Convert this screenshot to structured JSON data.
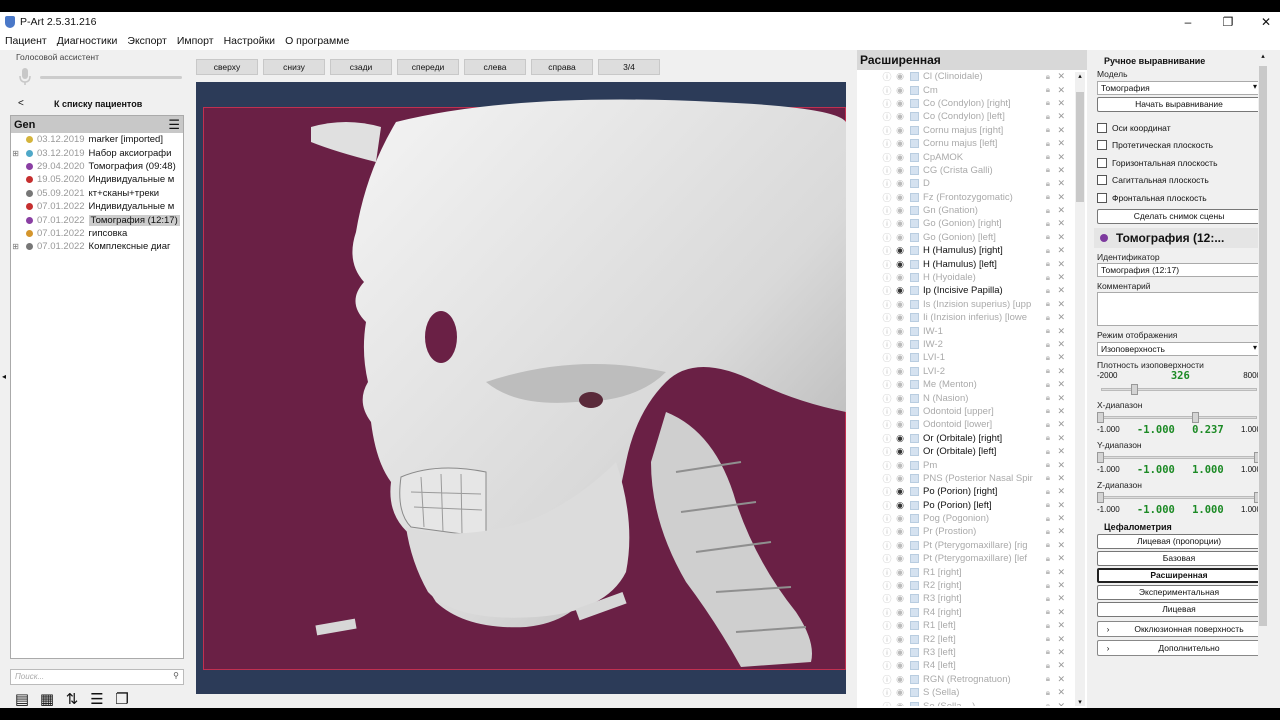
{
  "window": {
    "title": "P-Art 2.5.31.216",
    "minimize": "–",
    "maximize": "❐",
    "close": "✕"
  },
  "menu": [
    "Пациент",
    "Диагностики",
    "Экспорт",
    "Импорт",
    "Настройки",
    "О программе"
  ],
  "left": {
    "voice_label": "Голосовой ассистент",
    "back_label": "К списку пациентов",
    "patient_name": "Gen",
    "search_placeholder": "Поиск...",
    "items": [
      {
        "date": "03.12.2019",
        "label": "marker [imported]",
        "color": "#d4b43c",
        "expand": ""
      },
      {
        "date": "03.12.2019",
        "label": "Набор аксиографи",
        "color": "#4fa8c8",
        "expand": "⊞"
      },
      {
        "date": "29.04.2020",
        "label": "Томография (09:48)",
        "color": "#8a3fa3",
        "expand": ""
      },
      {
        "date": "19.05.2020",
        "label": "Индивидуальные м",
        "color": "#c62f2f",
        "expand": ""
      },
      {
        "date": "05.09.2021",
        "label": "кт+сканы+треки",
        "color": "#777777",
        "expand": ""
      },
      {
        "date": "07.01.2022",
        "label": "Индивидуальные м",
        "color": "#c62f2f",
        "expand": ""
      },
      {
        "date": "07.01.2022",
        "label": "Томография (12:17)",
        "color": "#8a3fa3",
        "expand": ""
      },
      {
        "date": "07.01.2022",
        "label": "гипсовка",
        "color": "#d4952c",
        "expand": ""
      },
      {
        "date": "07.01.2022",
        "label": "Комплексные диаг",
        "color": "#777777",
        "expand": "⊞"
      }
    ]
  },
  "views": [
    "сверху",
    "снизу",
    "сзади",
    "спереди",
    "слева",
    "справа",
    "3/4"
  ],
  "landmarks": {
    "title": "Расширенная",
    "items": [
      {
        "name": "Cl (Clinoidale)",
        "on": false
      },
      {
        "name": "Cm",
        "on": false
      },
      {
        "name": "Co (Condylon) [right]",
        "on": false
      },
      {
        "name": "Co (Condylon) [left]",
        "on": false
      },
      {
        "name": "Cornu majus [right]",
        "on": false
      },
      {
        "name": "Cornu majus [left]",
        "on": false
      },
      {
        "name": "CpAMOK",
        "on": false
      },
      {
        "name": "CG (Crista Galli)",
        "on": false
      },
      {
        "name": "D",
        "on": false
      },
      {
        "name": "Fz (Frontozygomatic)",
        "on": false
      },
      {
        "name": "Gn (Gnation)",
        "on": false
      },
      {
        "name": "Go (Gonion) [right]",
        "on": false
      },
      {
        "name": "Go (Gonion) [left]",
        "on": false
      },
      {
        "name": "H (Hamulus) [right]",
        "on": true
      },
      {
        "name": "H (Hamulus) [left]",
        "on": true
      },
      {
        "name": "H (Hyoidale)",
        "on": false
      },
      {
        "name": "Ip (Incisive Papilla)",
        "on": true
      },
      {
        "name": "Is (Inzision superius) [upp",
        "on": false
      },
      {
        "name": "Ii (Inzision inferius) [lowe",
        "on": false
      },
      {
        "name": "IW-1",
        "on": false
      },
      {
        "name": "IW-2",
        "on": false
      },
      {
        "name": "LVI-1",
        "on": false
      },
      {
        "name": "LVI-2",
        "on": false
      },
      {
        "name": "Me (Menton)",
        "on": false
      },
      {
        "name": "N (Nasion)",
        "on": false
      },
      {
        "name": "Odontoid [upper]",
        "on": false
      },
      {
        "name": "Odontoid [lower]",
        "on": false
      },
      {
        "name": "Or (Orbitale) [right]",
        "on": true
      },
      {
        "name": "Or (Orbitale) [left]",
        "on": true
      },
      {
        "name": "Pm",
        "on": false
      },
      {
        "name": "PNS (Posterior Nasal Spir",
        "on": false
      },
      {
        "name": "Po (Porion) [right]",
        "on": true
      },
      {
        "name": "Po (Porion) [left]",
        "on": true
      },
      {
        "name": "Pog (Pogonion)",
        "on": false
      },
      {
        "name": "Pr (Prostion)",
        "on": false
      },
      {
        "name": "Pt (Pterygomaxillare) [rig",
        "on": false
      },
      {
        "name": "Pt (Pterygomaxillare) [lef",
        "on": false
      },
      {
        "name": "R1 [right]",
        "on": false
      },
      {
        "name": "R2 [right]",
        "on": false
      },
      {
        "name": "R3 [right]",
        "on": false
      },
      {
        "name": "R4 [right]",
        "on": false
      },
      {
        "name": "R1 [left]",
        "on": false
      },
      {
        "name": "R2 [left]",
        "on": false
      },
      {
        "name": "R3 [left]",
        "on": false
      },
      {
        "name": "R4 [left]",
        "on": false
      },
      {
        "name": "RGN (Retrognatuon)",
        "on": false
      },
      {
        "name": "S (Sella)",
        "on": false
      },
      {
        "name": "Se (Sella ...)",
        "on": false
      }
    ]
  },
  "right": {
    "manual_title": "Ручное выравнивание",
    "model_label": "Модель",
    "model_value": "Томография",
    "start_align": "Начать выравнивание",
    "checkboxes": [
      "Оси координат",
      "Протетическая плоскость",
      "Горизонтальная плоскость",
      "Сагиттальная плоскость",
      "Фронтальная плоскость"
    ],
    "snapshot": "Сделать снимок сцены",
    "object_title": "Томография (12:...",
    "object_color": "#7d3a9e",
    "id_label": "Идентификатор",
    "id_value": "Томография (12:17)",
    "comment_label": "Комментарий",
    "mode_label": "Режим отображения",
    "mode_value": "Изоповерхность",
    "density_label": "Плотность изоповерхности",
    "density": {
      "min": "-2000",
      "value": "326",
      "max": "8000"
    },
    "x": {
      "label": "X-диапазон",
      "min": "-1.000",
      "lo": "-1.000",
      "hi": "0.237",
      "max": "1.000"
    },
    "y": {
      "label": "Y-диапазон",
      "min": "-1.000",
      "lo": "-1.000",
      "hi": "1.000",
      "max": "1.000"
    },
    "z": {
      "label": "Z-диапазон",
      "min": "-1.000",
      "lo": "-1.000",
      "hi": "1.000",
      "max": "1.000"
    },
    "ceph_title": "Цефалометрия",
    "ceph_buttons": [
      "Лицевая (пропорции)",
      "Базовая",
      "Расширенная",
      "Экспериментальная",
      "Лицевая"
    ],
    "ceph_active": "Расширенная",
    "occlusal": "Окклюзионная поверхность",
    "additional": "Дополнительно"
  }
}
